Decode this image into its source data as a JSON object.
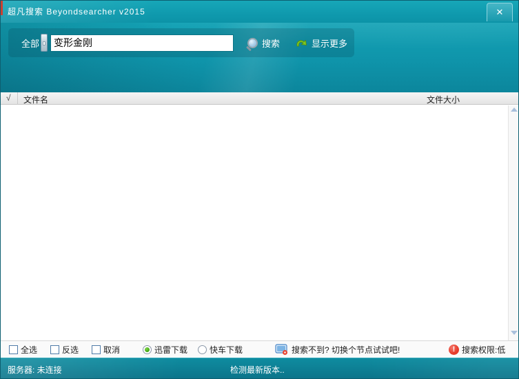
{
  "window": {
    "title": "超凡搜索 Beyondsearcher v2015",
    "close_glyph": "✕"
  },
  "search": {
    "scope_label": "全部",
    "query_value": "变形金刚",
    "query_placeholder": "",
    "search_button_label": "搜索",
    "show_more_label": "显示更多"
  },
  "list": {
    "select_all_glyph": "√",
    "columns": [
      {
        "label": "文件名"
      },
      {
        "label": "文件大小"
      }
    ],
    "rows": []
  },
  "toolbar": {
    "checkboxes": [
      {
        "label": "全选",
        "checked": false
      },
      {
        "label": "反选",
        "checked": false
      },
      {
        "label": "取消",
        "checked": false
      }
    ],
    "radios": [
      {
        "label": "迅雷下载",
        "selected": true
      },
      {
        "label": "快车下载",
        "selected": false
      }
    ],
    "hint_text": "搜索不到? 切换个节点试试吧!",
    "permission_icon_glyph": "!",
    "permission_text": "搜索权限:低"
  },
  "statusbar": {
    "server_status": "服务器: 未连接",
    "update_status": "检测最新版本.."
  },
  "colors": {
    "teal": "#0f94aa",
    "teal_dark": "#0b7389",
    "alert_red": "#e63b2a",
    "radio_green": "#41a413",
    "arrow_green": "#76c41c"
  }
}
